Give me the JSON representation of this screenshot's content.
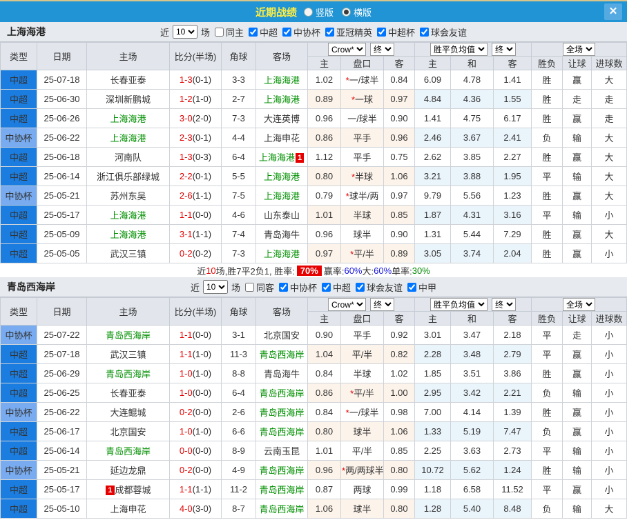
{
  "titlebar": {
    "title": "近期战绩",
    "view_options": [
      {
        "label": "竖版",
        "selected": false
      },
      {
        "label": "横版",
        "selected": true
      }
    ],
    "close_label": "✕"
  },
  "columns": {
    "main": [
      "类型",
      "日期",
      "主场",
      "比分(半场)",
      "角球",
      "客场"
    ],
    "odds_group": {
      "select1": "Crow*",
      "select2": "终",
      "subs": [
        "主",
        "盘口",
        "客"
      ]
    },
    "avg_group": {
      "select1": "胜平负均值",
      "select2": "终",
      "subs": [
        "主",
        "和",
        "客"
      ]
    },
    "result_group": {
      "select1": "全场",
      "subs": [
        "胜负",
        "让球",
        "进球数"
      ]
    }
  },
  "sections": [
    {
      "team": "上海海港",
      "filter": {
        "prefix": "近",
        "games": "10",
        "suffix": "场",
        "options": [
          {
            "label": "同主",
            "checked": false
          },
          {
            "label": "中超",
            "checked": true
          },
          {
            "label": "中协杯",
            "checked": true
          },
          {
            "label": "亚冠精英",
            "checked": true
          },
          {
            "label": "中超杯",
            "checked": true
          },
          {
            "label": "球会友谊",
            "checked": true
          }
        ]
      },
      "rows": [
        {
          "league": "中超",
          "league_class": "super",
          "date": "25-07-18",
          "home": {
            "name": "长春亚泰",
            "green": false
          },
          "score": "1-3",
          "half": "(0-1)",
          "corner": "3-3",
          "away": {
            "name": "上海海港",
            "green": true
          },
          "ah_home": "1.02",
          "ah_star": true,
          "ah_line": "一/球半",
          "ah_away": "0.84",
          "avg": [
            "6.09",
            "4.78",
            "1.41"
          ],
          "res": [
            {
              "t": "胜",
              "c": "r"
            },
            {
              "t": "赢",
              "c": "r"
            },
            {
              "t": "大",
              "c": "r"
            }
          ]
        },
        {
          "league": "中超",
          "league_class": "super",
          "date": "25-06-30",
          "home": {
            "name": "深圳新鹏城",
            "green": false
          },
          "score": "1-2",
          "half": "(1-0)",
          "corner": "2-7",
          "away": {
            "name": "上海海港",
            "green": true
          },
          "ah_home": "0.89",
          "ah_star": true,
          "ah_line": "一球",
          "ah_away": "0.97",
          "avg": [
            "4.84",
            "4.36",
            "1.55"
          ],
          "res": [
            {
              "t": "胜",
              "c": "r"
            },
            {
              "t": "走",
              "c": "b"
            },
            {
              "t": "走",
              "c": "b"
            }
          ]
        },
        {
          "league": "中超",
          "league_class": "super",
          "date": "25-06-26",
          "home": {
            "name": "上海海港",
            "green": true
          },
          "score": "3-0",
          "half": "(2-0)",
          "corner": "7-3",
          "away": {
            "name": "大连英博",
            "green": false
          },
          "ah_home": "0.96",
          "ah_star": false,
          "ah_line": "一/球半",
          "ah_away": "0.90",
          "avg": [
            "1.41",
            "4.75",
            "6.17"
          ],
          "res": [
            {
              "t": "胜",
              "c": "r"
            },
            {
              "t": "赢",
              "c": "r"
            },
            {
              "t": "走",
              "c": "b"
            }
          ]
        },
        {
          "league": "中协杯",
          "league_class": "cup",
          "date": "25-06-22",
          "home": {
            "name": "上海海港",
            "green": true
          },
          "score": "2-3",
          "half": "(0-1)",
          "corner": "4-4",
          "away": {
            "name": "上海申花",
            "green": false
          },
          "ah_home": "0.86",
          "ah_star": false,
          "ah_line": "平手",
          "ah_away": "0.96",
          "avg": [
            "2.46",
            "3.67",
            "2.41"
          ],
          "res": [
            {
              "t": "负",
              "c": "g"
            },
            {
              "t": "输",
              "c": "g"
            },
            {
              "t": "大",
              "c": "r"
            }
          ]
        },
        {
          "league": "中超",
          "league_class": "super",
          "date": "25-06-18",
          "home": {
            "name": "河南队",
            "green": false
          },
          "score": "1-3",
          "half": "(0-3)",
          "corner": "6-4",
          "away": {
            "name": "上海海港",
            "green": true,
            "badge": "1",
            "badge_pos": "after"
          },
          "ah_home": "1.12",
          "ah_star": false,
          "ah_line": "平手",
          "ah_away": "0.75",
          "avg": [
            "2.62",
            "3.85",
            "2.27"
          ],
          "res": [
            {
              "t": "胜",
              "c": "r"
            },
            {
              "t": "赢",
              "c": "r"
            },
            {
              "t": "大",
              "c": "r"
            }
          ]
        },
        {
          "league": "中超",
          "league_class": "super",
          "date": "25-06-14",
          "home": {
            "name": "浙江俱乐部绿城",
            "green": false
          },
          "score": "2-2",
          "half": "(0-1)",
          "corner": "5-5",
          "away": {
            "name": "上海海港",
            "green": true
          },
          "ah_home": "0.80",
          "ah_star": true,
          "ah_line": "半球",
          "ah_away": "1.06",
          "avg": [
            "3.21",
            "3.88",
            "1.95"
          ],
          "res": [
            {
              "t": "平",
              "c": "b"
            },
            {
              "t": "输",
              "c": "g"
            },
            {
              "t": "大",
              "c": "r"
            }
          ]
        },
        {
          "league": "中协杯",
          "league_class": "cup",
          "date": "25-05-21",
          "home": {
            "name": "苏州东吴",
            "green": false
          },
          "score": "2-6",
          "half": "(1-1)",
          "corner": "7-5",
          "away": {
            "name": "上海海港",
            "green": true
          },
          "ah_home": "0.79",
          "ah_star": true,
          "ah_line": "球半/两",
          "ah_away": "0.97",
          "avg": [
            "9.79",
            "5.56",
            "1.23"
          ],
          "res": [
            {
              "t": "胜",
              "c": "r"
            },
            {
              "t": "赢",
              "c": "r"
            },
            {
              "t": "大",
              "c": "r"
            }
          ]
        },
        {
          "league": "中超",
          "league_class": "super",
          "date": "25-05-17",
          "home": {
            "name": "上海海港",
            "green": true
          },
          "score": "1-1",
          "half": "(0-0)",
          "corner": "4-6",
          "away": {
            "name": "山东泰山",
            "green": false
          },
          "ah_home": "1.01",
          "ah_star": false,
          "ah_line": "半球",
          "ah_away": "0.85",
          "avg": [
            "1.87",
            "4.31",
            "3.16"
          ],
          "res": [
            {
              "t": "平",
              "c": "b"
            },
            {
              "t": "输",
              "c": "g"
            },
            {
              "t": "小",
              "c": "g"
            }
          ]
        },
        {
          "league": "中超",
          "league_class": "super",
          "date": "25-05-09",
          "home": {
            "name": "上海海港",
            "green": true
          },
          "score": "3-1",
          "half": "(1-1)",
          "corner": "7-4",
          "away": {
            "name": "青岛海牛",
            "green": false
          },
          "ah_home": "0.96",
          "ah_star": false,
          "ah_line": "球半",
          "ah_away": "0.90",
          "avg": [
            "1.31",
            "5.44",
            "7.29"
          ],
          "res": [
            {
              "t": "胜",
              "c": "r"
            },
            {
              "t": "赢",
              "c": "r"
            },
            {
              "t": "大",
              "c": "r"
            }
          ]
        },
        {
          "league": "中超",
          "league_class": "super",
          "date": "25-05-05",
          "home": {
            "name": "武汉三镇",
            "green": false
          },
          "score": "0-2",
          "half": "(0-2)",
          "corner": "7-3",
          "away": {
            "name": "上海海港",
            "green": true
          },
          "ah_home": "0.97",
          "ah_star": true,
          "ah_line": "平/半",
          "ah_away": "0.89",
          "avg": [
            "3.05",
            "3.74",
            "2.04"
          ],
          "res": [
            {
              "t": "胜",
              "c": "r"
            },
            {
              "t": "赢",
              "c": "r"
            },
            {
              "t": "小",
              "c": "g"
            }
          ]
        }
      ],
      "summary": [
        {
          "t": "近"
        },
        {
          "t": "10",
          "c": "red"
        },
        {
          "t": "场,胜7平2负1, 胜率:"
        },
        {
          "t": "70%",
          "badge": true
        },
        {
          "t": "赢率:"
        },
        {
          "t": "60%",
          "c": "blue"
        },
        {
          "t": " 大:"
        },
        {
          "t": "60%",
          "c": "blue"
        },
        {
          "t": " 单率:"
        },
        {
          "t": "30%",
          "c": "green"
        }
      ]
    },
    {
      "team": "青岛西海岸",
      "filter": {
        "prefix": "近",
        "games": "10",
        "suffix": "场",
        "options": [
          {
            "label": "同客",
            "checked": false
          },
          {
            "label": "中协杯",
            "checked": true
          },
          {
            "label": "中超",
            "checked": true
          },
          {
            "label": "球会友谊",
            "checked": true
          },
          {
            "label": "中甲",
            "checked": true
          }
        ]
      },
      "rows": [
        {
          "league": "中协杯",
          "league_class": "cup",
          "date": "25-07-22",
          "home": {
            "name": "青岛西海岸",
            "green": true
          },
          "score": "1-1",
          "half": "(0-0)",
          "corner": "3-1",
          "away": {
            "name": "北京国安",
            "green": false
          },
          "ah_home": "0.90",
          "ah_star": false,
          "ah_line": "平手",
          "ah_away": "0.92",
          "avg": [
            "3.01",
            "3.47",
            "2.18"
          ],
          "res": [
            {
              "t": "平",
              "c": "b"
            },
            {
              "t": "走",
              "c": "b"
            },
            {
              "t": "小",
              "c": "g"
            }
          ]
        },
        {
          "league": "中超",
          "league_class": "super",
          "date": "25-07-18",
          "home": {
            "name": "武汉三镇",
            "green": false
          },
          "score": "1-1",
          "half": "(1-0)",
          "corner": "11-3",
          "away": {
            "name": "青岛西海岸",
            "green": true
          },
          "ah_home": "1.04",
          "ah_star": false,
          "ah_line": "平/半",
          "ah_away": "0.82",
          "avg": [
            "2.28",
            "3.48",
            "2.79"
          ],
          "res": [
            {
              "t": "平",
              "c": "b"
            },
            {
              "t": "赢",
              "c": "r"
            },
            {
              "t": "小",
              "c": "g"
            }
          ]
        },
        {
          "league": "中超",
          "league_class": "super",
          "date": "25-06-29",
          "home": {
            "name": "青岛西海岸",
            "green": true
          },
          "score": "1-0",
          "half": "(1-0)",
          "corner": "8-8",
          "away": {
            "name": "青岛海牛",
            "green": false
          },
          "ah_home": "0.84",
          "ah_star": false,
          "ah_line": "半球",
          "ah_away": "1.02",
          "avg": [
            "1.85",
            "3.51",
            "3.86"
          ],
          "res": [
            {
              "t": "胜",
              "c": "r"
            },
            {
              "t": "赢",
              "c": "r"
            },
            {
              "t": "小",
              "c": "g"
            }
          ]
        },
        {
          "league": "中超",
          "league_class": "super",
          "date": "25-06-25",
          "home": {
            "name": "长春亚泰",
            "green": false
          },
          "score": "1-0",
          "half": "(0-0)",
          "corner": "6-4",
          "away": {
            "name": "青岛西海岸",
            "green": true
          },
          "ah_home": "0.86",
          "ah_star": true,
          "ah_line": "平/半",
          "ah_away": "1.00",
          "avg": [
            "2.95",
            "3.42",
            "2.21"
          ],
          "res": [
            {
              "t": "负",
              "c": "g"
            },
            {
              "t": "输",
              "c": "g"
            },
            {
              "t": "小",
              "c": "g"
            }
          ]
        },
        {
          "league": "中协杯",
          "league_class": "cup",
          "date": "25-06-22",
          "home": {
            "name": "大连鲲城",
            "green": false
          },
          "score": "0-2",
          "half": "(0-0)",
          "corner": "2-6",
          "away": {
            "name": "青岛西海岸",
            "green": true
          },
          "ah_home": "0.84",
          "ah_star": true,
          "ah_line": "一/球半",
          "ah_away": "0.98",
          "avg": [
            "7.00",
            "4.14",
            "1.39"
          ],
          "res": [
            {
              "t": "胜",
              "c": "r"
            },
            {
              "t": "赢",
              "c": "r"
            },
            {
              "t": "小",
              "c": "g"
            }
          ]
        },
        {
          "league": "中超",
          "league_class": "super",
          "date": "25-06-17",
          "home": {
            "name": "北京国安",
            "green": false
          },
          "score": "1-0",
          "half": "(1-0)",
          "corner": "6-6",
          "away": {
            "name": "青岛西海岸",
            "green": true
          },
          "ah_home": "0.80",
          "ah_star": false,
          "ah_line": "球半",
          "ah_away": "1.06",
          "avg": [
            "1.33",
            "5.19",
            "7.47"
          ],
          "res": [
            {
              "t": "负",
              "c": "g"
            },
            {
              "t": "赢",
              "c": "r"
            },
            {
              "t": "小",
              "c": "g"
            }
          ]
        },
        {
          "league": "中超",
          "league_class": "super",
          "date": "25-06-14",
          "home": {
            "name": "青岛西海岸",
            "green": true
          },
          "score": "0-0",
          "half": "(0-0)",
          "corner": "8-9",
          "away": {
            "name": "云南玉昆",
            "green": false
          },
          "ah_home": "1.01",
          "ah_star": false,
          "ah_line": "平/半",
          "ah_away": "0.85",
          "avg": [
            "2.25",
            "3.63",
            "2.73"
          ],
          "res": [
            {
              "t": "平",
              "c": "b"
            },
            {
              "t": "输",
              "c": "g"
            },
            {
              "t": "小",
              "c": "g"
            }
          ]
        },
        {
          "league": "中协杯",
          "league_class": "cup",
          "date": "25-05-21",
          "home": {
            "name": "延边龙鼎",
            "green": false
          },
          "score": "0-2",
          "half": "(0-0)",
          "corner": "4-9",
          "away": {
            "name": "青岛西海岸",
            "green": true
          },
          "ah_home": "0.96",
          "ah_star": true,
          "ah_line": "两/两球半",
          "ah_away": "0.80",
          "avg": [
            "10.72",
            "5.62",
            "1.24"
          ],
          "res": [
            {
              "t": "胜",
              "c": "r"
            },
            {
              "t": "输",
              "c": "g"
            },
            {
              "t": "小",
              "c": "g"
            }
          ]
        },
        {
          "league": "中超",
          "league_class": "super",
          "date": "25-05-17",
          "home": {
            "name": "成都蓉城",
            "green": false,
            "badge": "1",
            "badge_pos": "before"
          },
          "score": "1-1",
          "half": "(1-1)",
          "corner": "11-2",
          "away": {
            "name": "青岛西海岸",
            "green": true
          },
          "ah_home": "0.87",
          "ah_star": false,
          "ah_line": "两球",
          "ah_away": "0.99",
          "avg": [
            "1.18",
            "6.58",
            "11.52"
          ],
          "res": [
            {
              "t": "平",
              "c": "b"
            },
            {
              "t": "赢",
              "c": "r"
            },
            {
              "t": "小",
              "c": "g"
            }
          ]
        },
        {
          "league": "中超",
          "league_class": "super",
          "date": "25-05-10",
          "home": {
            "name": "上海申花",
            "green": false
          },
          "score": "4-0",
          "half": "(3-0)",
          "corner": "8-7",
          "away": {
            "name": "青岛西海岸",
            "green": true
          },
          "ah_home": "1.06",
          "ah_star": false,
          "ah_line": "球半",
          "ah_away": "0.80",
          "avg": [
            "1.28",
            "5.40",
            "8.48"
          ],
          "res": [
            {
              "t": "负",
              "c": "g"
            },
            {
              "t": "输",
              "c": "g"
            },
            {
              "t": "大",
              "c": "r"
            }
          ]
        }
      ],
      "summary": []
    }
  ]
}
